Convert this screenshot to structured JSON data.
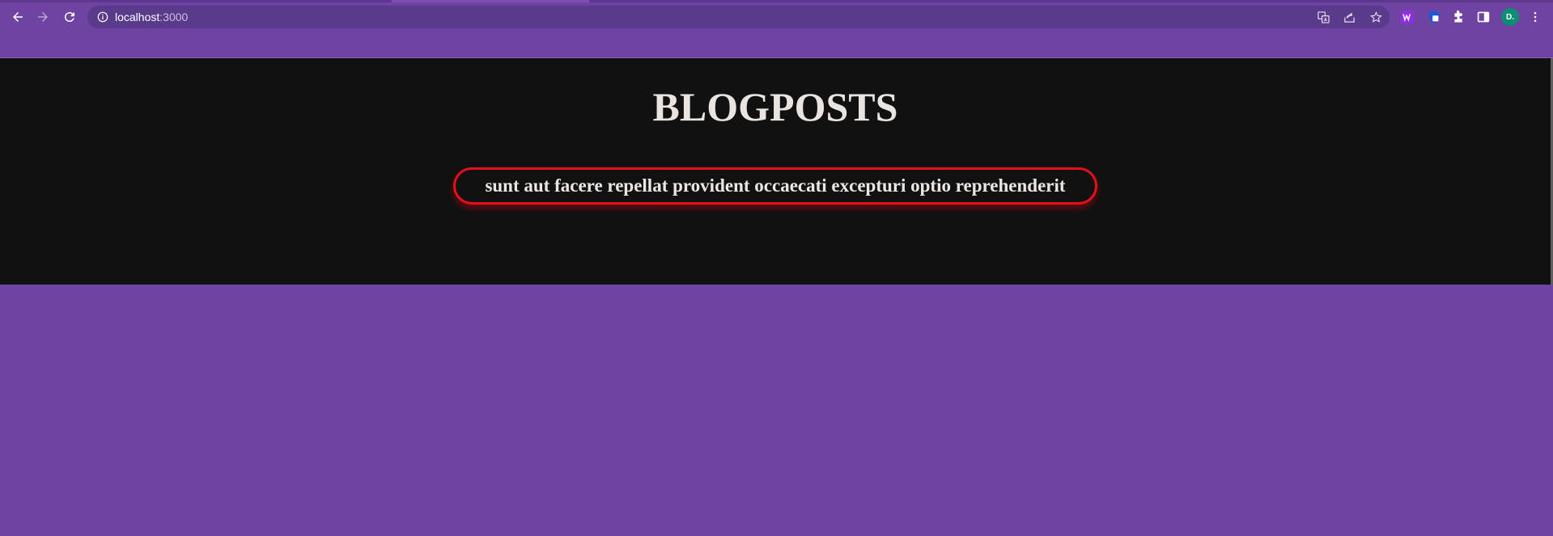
{
  "browser": {
    "url_host": "localhost",
    "url_port": ":3000",
    "avatar_initials": "D.",
    "icons": {
      "back": "arrow-left-icon",
      "forward": "arrow-right-icon",
      "reload": "reload-icon",
      "site_info": "info-icon",
      "translate": "translate-icon",
      "share": "share-icon",
      "bookmark": "star-icon",
      "extension_1": "w-extension-icon",
      "extension_2": "shield-extension-icon",
      "extensions": "puzzle-icon",
      "side_panel": "side-panel-icon",
      "menu": "kebab-menu-icon"
    }
  },
  "page": {
    "title": "BLOGPOSTS",
    "posts": [
      {
        "title": "sunt aut facere repellat provident occaecati excepturi optio reprehenderit"
      }
    ]
  },
  "colors": {
    "page_background": "#6f43a2",
    "section_background": "#111111",
    "post_border": "#e3101a",
    "text": "#ece6e2"
  }
}
